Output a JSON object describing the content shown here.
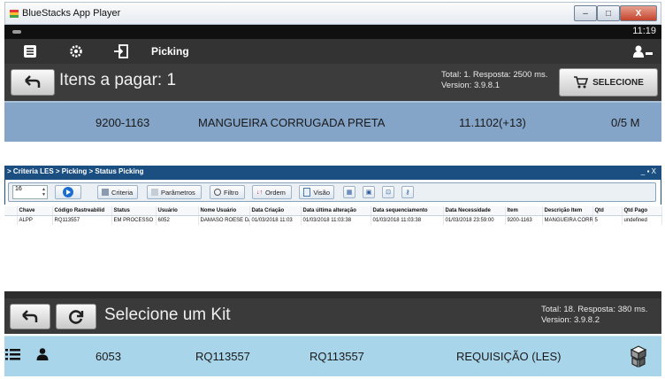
{
  "bluestacks": {
    "window_title": "BlueStacks App Player",
    "window_controls": [
      "–",
      "□",
      "X"
    ],
    "clock": "11:19",
    "appbar": {
      "title": "Picking"
    },
    "header": {
      "title": "Itens a pagar: 1",
      "total_line1": "Total: 1. Resposta: 2500 ms.",
      "total_line2": "Version: 3.9.8.1",
      "select_button": "SELECIONE"
    },
    "row": {
      "code": "9200-1163",
      "description": "MANGUEIRA CORRUGADA PRETA",
      "location": "11.1102(+13)",
      "quantity": "0/5 M"
    }
  },
  "criteria": {
    "breadcrumb": "> Criteria LES > Picking > Status Picking",
    "window_controls": "_ ▪ X",
    "page_size": "16",
    "toolbar": {
      "criteria": "Criteria",
      "parametros": "Parâmetros",
      "filtro": "Filtro",
      "ordem": "Ordem",
      "visao": "Visão"
    },
    "columns": [
      "Chave",
      "Código Rastreabilid",
      "Status",
      "Usuário",
      "Nome Usuário",
      "Data Criação",
      "Data última alteração",
      "Data sequenciamento",
      "Data Necessidade",
      "Item",
      "Descrição Item",
      "Qtd",
      "Qtd Pago"
    ],
    "rows": [
      [
        "ALPP",
        "RQ113557",
        "EM PROCESSO",
        "6052",
        "DAMASO ROESE DA",
        "01/03/2018 11:03",
        "01/03/2018 11:03:38",
        "01/03/2018 11:03:38",
        "01/03/2018 23:59:00",
        "9200-1163",
        "MANGUEIRA CORRU",
        "5",
        "undefined"
      ]
    ]
  },
  "kits": {
    "title": "Selecione um Kit",
    "total_line1": "Total: 18. Resposta: 380 ms.",
    "total_line2": "Version: 3.9.8.2",
    "row": {
      "user": "6053",
      "code1": "RQ113557",
      "code2": "RQ113557",
      "type": "REQUISIÇÃO (LES)"
    }
  }
}
